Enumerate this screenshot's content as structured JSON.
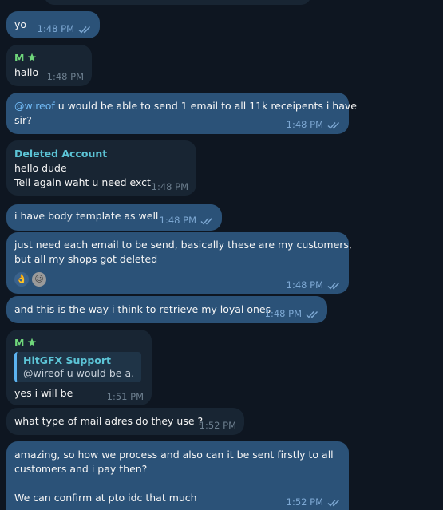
{
  "messages": [
    {
      "id": "m1",
      "text": "yo",
      "time": "1:48 PM"
    },
    {
      "id": "m2",
      "sender": "M",
      "text": "hallo",
      "time": "1:48 PM"
    },
    {
      "id": "m3",
      "mention": "@wireof",
      "text_line1": " u would be able to send 1 email to all 11k receipents i have",
      "text_line2": "sir?",
      "time": "1:48 PM"
    },
    {
      "id": "m4",
      "sender": "Deleted Account",
      "text_line1": "hello dude",
      "text_line2": "Tell again waht u need exct",
      "time": "1:48 PM"
    },
    {
      "id": "m5",
      "text": "i have body template as well",
      "time": "1:48 PM"
    },
    {
      "id": "m6",
      "text_line1": "just need each email to be send, basically these are my customers,",
      "text_line2": "but all my shops got deleted",
      "time": "1:48 PM",
      "reactions": [
        "ok-hand-reaction",
        "avatar-reaction"
      ]
    },
    {
      "id": "m7",
      "text": "and this is the way i think to retrieve my loyal ones",
      "time": "1:48 PM"
    },
    {
      "id": "m8",
      "sender": "M",
      "reply_name": "HitGFX Support",
      "reply_text": "@wireof u would be a…",
      "text": "yes i will be",
      "time": "1:51 PM"
    },
    {
      "id": "m9",
      "text": "what type of mail adres do they use ?",
      "time": "1:52 PM"
    },
    {
      "id": "m10",
      "text_line1": "amazing, so how we process and also can it be sent firstly to all",
      "text_line2": "customers and i pay then?",
      "text_line3": "We can confirm at pto idc that much",
      "time": "1:52 PM"
    }
  ],
  "colors": {
    "outgoing": "#2b5278",
    "incoming": "#182533",
    "background": "#0e1621",
    "sender_m": "#6fd67b",
    "sender_deleted": "#5cc4d6"
  }
}
